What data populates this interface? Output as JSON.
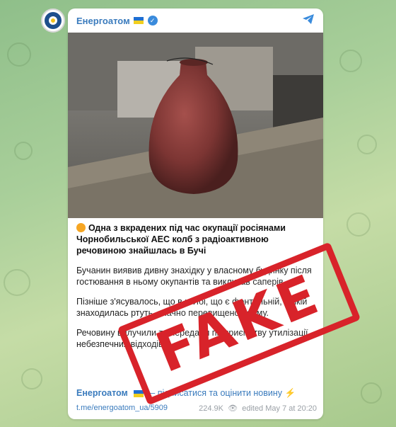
{
  "channel": {
    "name": "Енергоатом",
    "flag_icon": "ukraine-flag-icon",
    "verified_icon": "verified-badge-icon",
    "share_icon": "telegram-send-icon",
    "accent": "#3a7bbd"
  },
  "post": {
    "headline": "Одна з вкрадених під час окупації росіянами Чорнобильської АЕС колб з радіоактивною речовиною знайшлась в Бучі",
    "headline_emoji": "radioactive-face-emoji",
    "paragraphs": [
      "Бучанин виявив дивну знахідку у власному будинку після гостювання в ньому окупантів та викликав саперів.",
      "Пізніше з'ясувалось, що в колбі, що є фонтальній, в якій знаходилась ртуть, значно перевищено норму.",
      "Речовину вилучили та передали підприємству утилізації небезпечних відходів."
    ],
    "footer_text": "Енергоатом",
    "footer_suffix": "— підписатися та оцінити новину ⚡",
    "link": "t.me/energoatom_ua/5909",
    "views": "224.9K",
    "edited": "edited May 7 at 20:20"
  },
  "stamp": {
    "text": "FAKE",
    "color": "#d8232a"
  }
}
